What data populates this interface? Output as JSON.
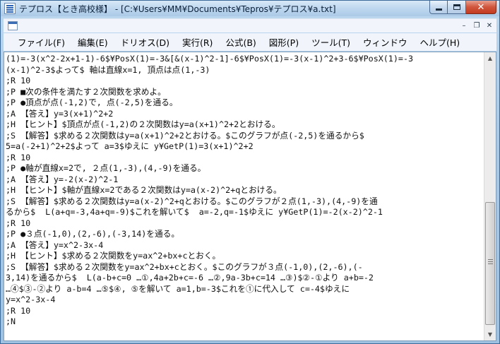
{
  "window": {
    "title": "テプロス【とき高校様】 - [C:¥Users¥MM¥Documents¥Tepros¥テプロス¥a.txt]"
  },
  "caption": {
    "minimize_icon": "minimize-icon",
    "maximize_icon": "maximize-icon",
    "close_icon": "close-icon",
    "close_glyph": "✕"
  },
  "mdi": {
    "minimize_glyph": "–",
    "restore_glyph": "❐",
    "close_glyph": "✕"
  },
  "menu": {
    "items": [
      {
        "label": "ファイル(F)"
      },
      {
        "label": "編集(E)"
      },
      {
        "label": "ドリオス(D)"
      },
      {
        "label": "実行(R)"
      },
      {
        "label": "公式(B)"
      },
      {
        "label": "図形(P)"
      },
      {
        "label": "ツール(T)"
      },
      {
        "label": "ウィンドウ"
      },
      {
        "label": "ヘルプ(H)"
      }
    ]
  },
  "editor": {
    "lines": [
      "(1)=-3(x^2-2x+1-1)-6$¥PosX(1)=-3&[&(x-1)^2-1]-6$¥PosX(1)=-3(x-1)^2+3-6$¥PosX(1)=-3",
      "(x-1)^2-3$よって$ 軸は直線x=1, 頂点は点(1,-3)",
      ";R 10",
      ";P ■次の条件を満たす２次関数を求めよ。",
      ";P ●頂点が点(-1,2)で, 点(-2,5)を通る。",
      ";A 【答え】y=3(x+1)^2+2",
      ";H 【ヒント】$頂点が点(-1,2)の２次関数はy=a(x+1)^2+2とおける。",
      ";S 【解答】$求める２次関数はy=a(x+1)^2+2とおける。$このグラフが点(-2,5)を通るから$",
      "5=a(-2+1)^2+2$よって a=3$ゆえに y¥GetP(1)=3(x+1)^2+2",
      ";R 10",
      ";P ●軸が直線x=2で, ２点(1,-3),(4,-9)を通る。",
      ";A 【答え】y=-2(x-2)^2-1",
      ";H 【ヒント】$軸が直線x=2である２次関数はy=a(x-2)^2+qとおける。",
      ";S 【解答】$求める２次関数はy=a(x-2)^2+qとおける。$このグラフが２点(1,-3),(4,-9)を通",
      "るから$  L(a+q=-3,4a+q=-9)$これを解いて$  a=-2,q=-1$ゆえに y¥GetP(1)=-2(x-2)^2-1",
      ";R 10",
      ";P ●３点(-1,0),(2,-6),(-3,14)を通る。",
      ";A 【答え】y=x^2-3x-4",
      ";H 【ヒント】$求める２次関数をy=ax^2+bx+cとおく。",
      ";S 【解答】$求める２次関数をy=ax^2+bx+cとおく。$このグラフが３点(-1,0),(2,-6),(-",
      "3,14)を通るから$  L(a-b+c=0 …①,4a+2b+c=-6 …②,9a-3b+c=14 …③)$②-①より a+b=-2",
      "…④$③-②より a-b=4 …⑤$④, ⑤を解いて a=1,b=-3$これを①に代入して c=-4$ゆえに",
      "y=x^2-3x-4",
      ";R 10",
      ";N"
    ]
  },
  "scrollbar": {
    "up_glyph": "▲",
    "down_glyph": "▼"
  }
}
